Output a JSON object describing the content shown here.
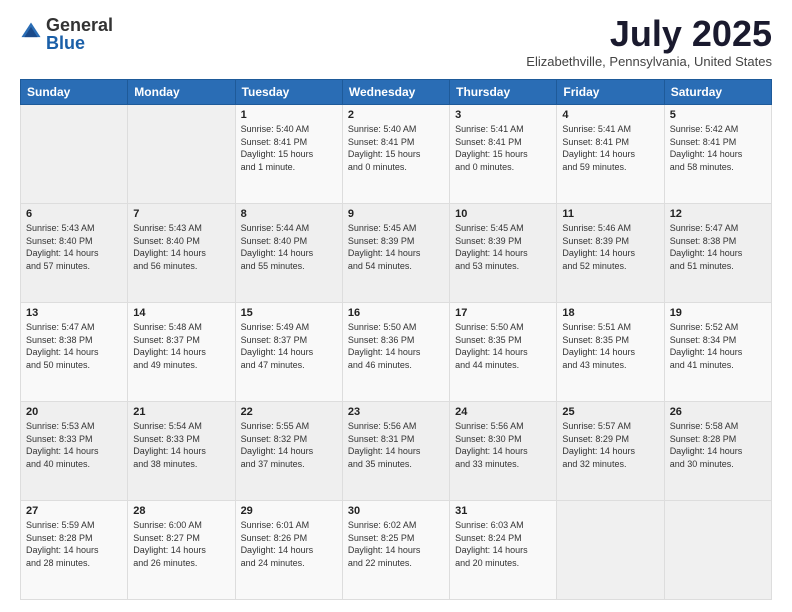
{
  "header": {
    "logo_general": "General",
    "logo_blue": "Blue",
    "title": "July 2025",
    "location": "Elizabethville, Pennsylvania, United States"
  },
  "days_of_week": [
    "Sunday",
    "Monday",
    "Tuesday",
    "Wednesday",
    "Thursday",
    "Friday",
    "Saturday"
  ],
  "weeks": [
    [
      {
        "day": "",
        "info": ""
      },
      {
        "day": "",
        "info": ""
      },
      {
        "day": "1",
        "info": "Sunrise: 5:40 AM\nSunset: 8:41 PM\nDaylight: 15 hours\nand 1 minute."
      },
      {
        "day": "2",
        "info": "Sunrise: 5:40 AM\nSunset: 8:41 PM\nDaylight: 15 hours\nand 0 minutes."
      },
      {
        "day": "3",
        "info": "Sunrise: 5:41 AM\nSunset: 8:41 PM\nDaylight: 15 hours\nand 0 minutes."
      },
      {
        "day": "4",
        "info": "Sunrise: 5:41 AM\nSunset: 8:41 PM\nDaylight: 14 hours\nand 59 minutes."
      },
      {
        "day": "5",
        "info": "Sunrise: 5:42 AM\nSunset: 8:41 PM\nDaylight: 14 hours\nand 58 minutes."
      }
    ],
    [
      {
        "day": "6",
        "info": "Sunrise: 5:43 AM\nSunset: 8:40 PM\nDaylight: 14 hours\nand 57 minutes."
      },
      {
        "day": "7",
        "info": "Sunrise: 5:43 AM\nSunset: 8:40 PM\nDaylight: 14 hours\nand 56 minutes."
      },
      {
        "day": "8",
        "info": "Sunrise: 5:44 AM\nSunset: 8:40 PM\nDaylight: 14 hours\nand 55 minutes."
      },
      {
        "day": "9",
        "info": "Sunrise: 5:45 AM\nSunset: 8:39 PM\nDaylight: 14 hours\nand 54 minutes."
      },
      {
        "day": "10",
        "info": "Sunrise: 5:45 AM\nSunset: 8:39 PM\nDaylight: 14 hours\nand 53 minutes."
      },
      {
        "day": "11",
        "info": "Sunrise: 5:46 AM\nSunset: 8:39 PM\nDaylight: 14 hours\nand 52 minutes."
      },
      {
        "day": "12",
        "info": "Sunrise: 5:47 AM\nSunset: 8:38 PM\nDaylight: 14 hours\nand 51 minutes."
      }
    ],
    [
      {
        "day": "13",
        "info": "Sunrise: 5:47 AM\nSunset: 8:38 PM\nDaylight: 14 hours\nand 50 minutes."
      },
      {
        "day": "14",
        "info": "Sunrise: 5:48 AM\nSunset: 8:37 PM\nDaylight: 14 hours\nand 49 minutes."
      },
      {
        "day": "15",
        "info": "Sunrise: 5:49 AM\nSunset: 8:37 PM\nDaylight: 14 hours\nand 47 minutes."
      },
      {
        "day": "16",
        "info": "Sunrise: 5:50 AM\nSunset: 8:36 PM\nDaylight: 14 hours\nand 46 minutes."
      },
      {
        "day": "17",
        "info": "Sunrise: 5:50 AM\nSunset: 8:35 PM\nDaylight: 14 hours\nand 44 minutes."
      },
      {
        "day": "18",
        "info": "Sunrise: 5:51 AM\nSunset: 8:35 PM\nDaylight: 14 hours\nand 43 minutes."
      },
      {
        "day": "19",
        "info": "Sunrise: 5:52 AM\nSunset: 8:34 PM\nDaylight: 14 hours\nand 41 minutes."
      }
    ],
    [
      {
        "day": "20",
        "info": "Sunrise: 5:53 AM\nSunset: 8:33 PM\nDaylight: 14 hours\nand 40 minutes."
      },
      {
        "day": "21",
        "info": "Sunrise: 5:54 AM\nSunset: 8:33 PM\nDaylight: 14 hours\nand 38 minutes."
      },
      {
        "day": "22",
        "info": "Sunrise: 5:55 AM\nSunset: 8:32 PM\nDaylight: 14 hours\nand 37 minutes."
      },
      {
        "day": "23",
        "info": "Sunrise: 5:56 AM\nSunset: 8:31 PM\nDaylight: 14 hours\nand 35 minutes."
      },
      {
        "day": "24",
        "info": "Sunrise: 5:56 AM\nSunset: 8:30 PM\nDaylight: 14 hours\nand 33 minutes."
      },
      {
        "day": "25",
        "info": "Sunrise: 5:57 AM\nSunset: 8:29 PM\nDaylight: 14 hours\nand 32 minutes."
      },
      {
        "day": "26",
        "info": "Sunrise: 5:58 AM\nSunset: 8:28 PM\nDaylight: 14 hours\nand 30 minutes."
      }
    ],
    [
      {
        "day": "27",
        "info": "Sunrise: 5:59 AM\nSunset: 8:28 PM\nDaylight: 14 hours\nand 28 minutes."
      },
      {
        "day": "28",
        "info": "Sunrise: 6:00 AM\nSunset: 8:27 PM\nDaylight: 14 hours\nand 26 minutes."
      },
      {
        "day": "29",
        "info": "Sunrise: 6:01 AM\nSunset: 8:26 PM\nDaylight: 14 hours\nand 24 minutes."
      },
      {
        "day": "30",
        "info": "Sunrise: 6:02 AM\nSunset: 8:25 PM\nDaylight: 14 hours\nand 22 minutes."
      },
      {
        "day": "31",
        "info": "Sunrise: 6:03 AM\nSunset: 8:24 PM\nDaylight: 14 hours\nand 20 minutes."
      },
      {
        "day": "",
        "info": ""
      },
      {
        "day": "",
        "info": ""
      }
    ]
  ]
}
